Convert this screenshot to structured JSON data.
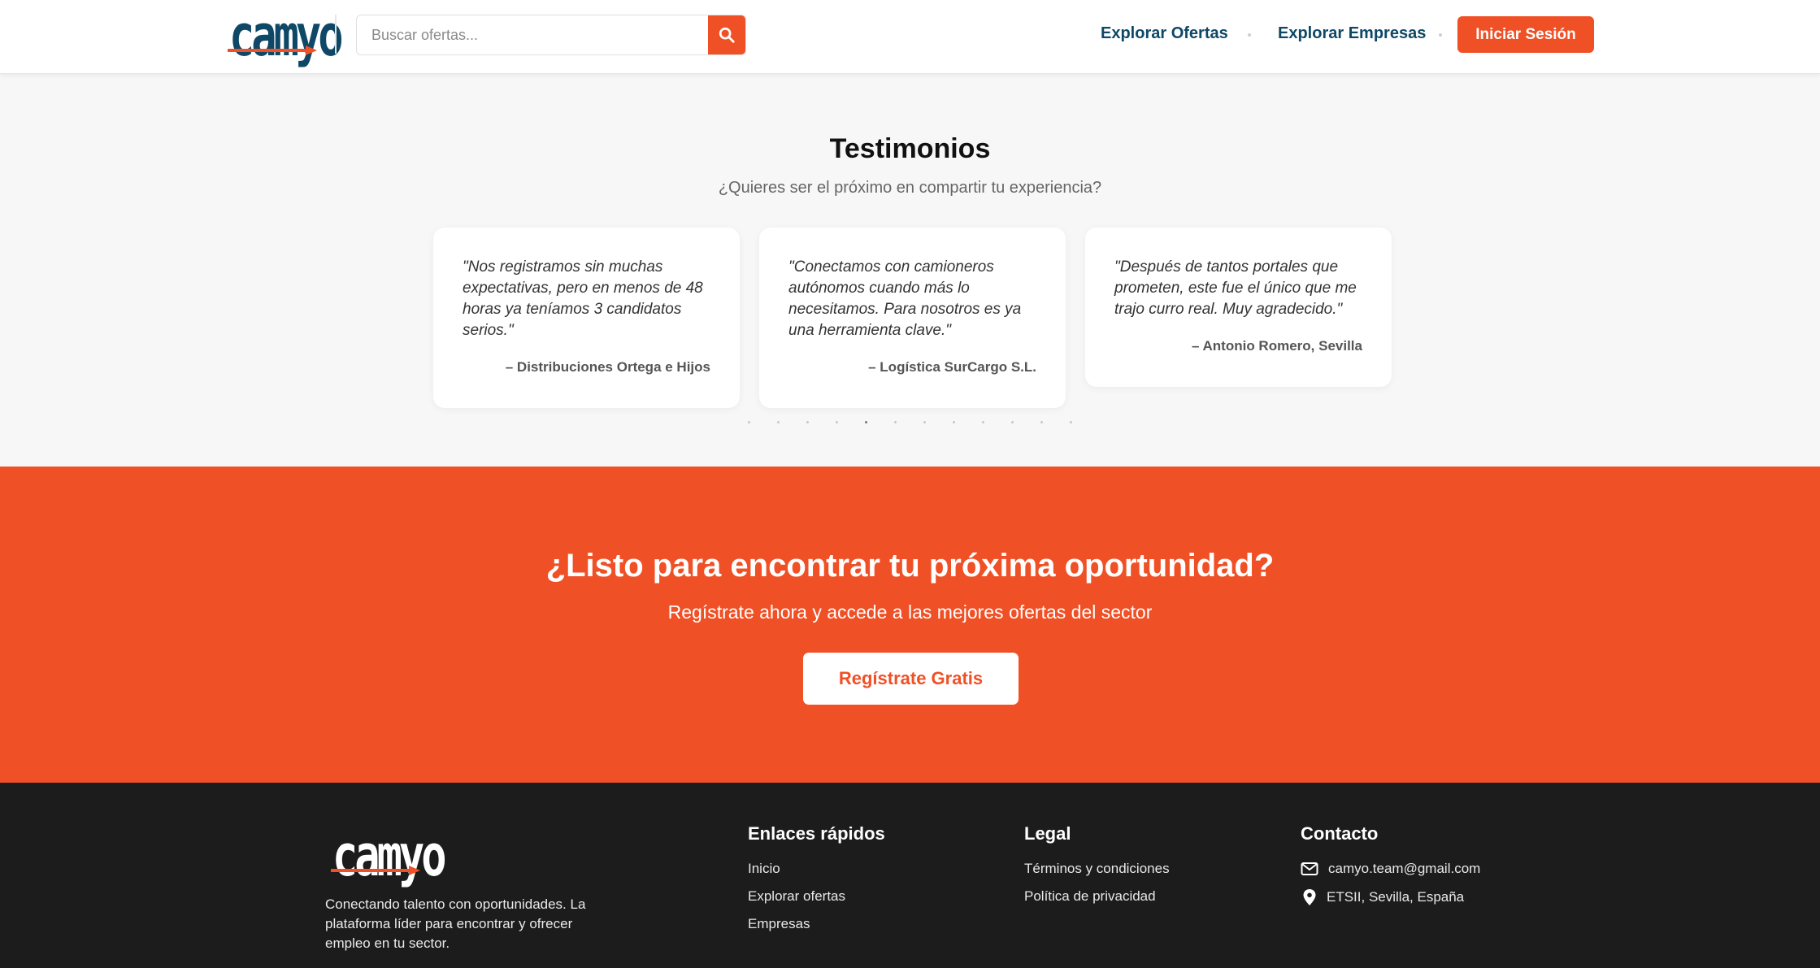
{
  "header": {
    "logo_text": "camyo",
    "search_placeholder": "Buscar ofertas...",
    "nav": [
      {
        "label": "Explorar Ofertas"
      },
      {
        "label": "Explorar Empresas"
      }
    ],
    "login_label": "Iniciar Sesión"
  },
  "testimonials": {
    "title": "Testimonios",
    "subtitle": "¿Quieres ser el próximo en compartir tu experiencia?",
    "items": [
      {
        "quote": "\"Nos registramos sin muchas expectativas, pero en menos de 48 horas ya teníamos 3 candidatos serios.\"",
        "author": "– Distribuciones Ortega e Hijos"
      },
      {
        "quote": "\"Conectamos con camioneros autónomos cuando más lo necesitamos. Para nosotros es ya una herramienta clave.\"",
        "author": "– Logística SurCargo S.L."
      },
      {
        "quote": "\"Después de tantos portales que prometen, este fue el único que me trajo curro real. Muy agradecido.\"",
        "author": "– Antonio Romero, Sevilla"
      }
    ],
    "pagination": {
      "total": 12,
      "active": 5
    }
  },
  "cta": {
    "title": "¿Listo para encontrar tu próxima oportunidad?",
    "subtitle": "Regístrate ahora y accede a las mejores ofertas del sector",
    "button_label": "Regístrate Gratis"
  },
  "footer": {
    "logo_text": "camyo",
    "description": "Conectando talento con oportunidades. La plataforma líder para encontrar y ofrecer empleo en tu sector.",
    "quick_links": {
      "title": "Enlaces rápidos",
      "items": [
        "Inicio",
        "Explorar ofertas",
        "Empresas"
      ]
    },
    "legal": {
      "title": "Legal",
      "items": [
        "Términos y condiciones",
        "Política de privacidad"
      ]
    },
    "contact": {
      "title": "Contacto",
      "email": "camyo.team@gmail.com",
      "address": "ETSII, Sevilla, España"
    }
  },
  "colors": {
    "accent": "#f05025",
    "brand": "#0e4866",
    "footer_bg": "#1c1c1c"
  }
}
